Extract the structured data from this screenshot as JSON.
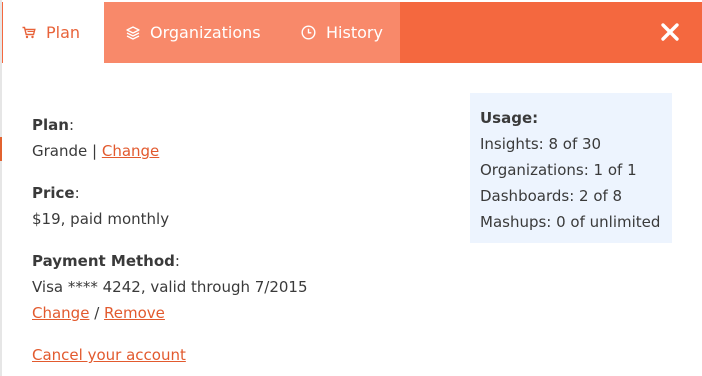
{
  "tabs": {
    "plan": "Plan",
    "organizations": "Organizations",
    "history": "History"
  },
  "close_label": "✕",
  "plan": {
    "label": "Plan",
    "value": "Grande",
    "separator": " | ",
    "change_link": "Change"
  },
  "price": {
    "label": "Price",
    "value": "$19, paid monthly"
  },
  "payment": {
    "label": "Payment Method",
    "value": "Visa **** 4242, valid through 7/2015",
    "change_link": "Change",
    "separator": " / ",
    "remove_link": "Remove"
  },
  "cancel_link": "Cancel your account",
  "usage": {
    "title": "Usage:",
    "rows": [
      "Insights: 8 of 30",
      "Organizations: 1 of 1",
      "Dashboards: 2 of 8",
      "Mashups: 0 of unlimited"
    ]
  },
  "colors": {
    "accent": "#f4683f",
    "inactive_tab": "#f8896a",
    "link": "#e25a2e",
    "usage_bg": "#edf4fe"
  },
  "icons": {
    "plan": "cart-icon",
    "organizations": "layers-icon",
    "history": "clock-icon",
    "close": "close-icon"
  }
}
